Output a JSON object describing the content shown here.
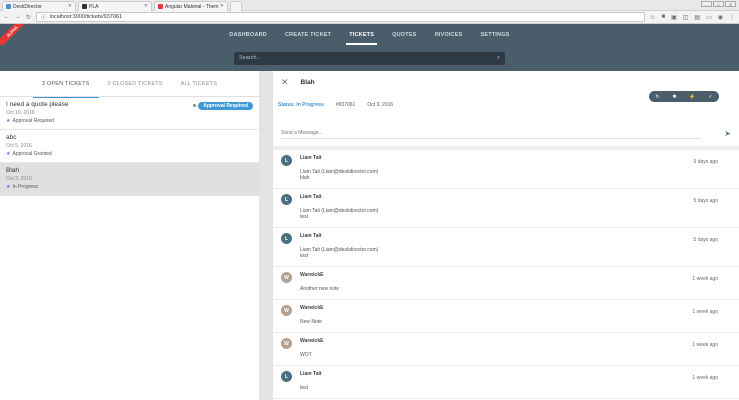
{
  "browser": {
    "tabs": [
      {
        "title": "DeskDirector",
        "fav": "#4a90d9"
      },
      {
        "title": "PLA",
        "fav": "#333333"
      },
      {
        "title": "Angular Material - Them",
        "fav": "#e53935"
      }
    ],
    "url": "localhost:3000/tickets/937061"
  },
  "badge": "ALPHA",
  "nav": {
    "items": [
      "DASHBOARD",
      "CREATE TICKET",
      "TICKETS",
      "QUOTES",
      "INVOICES",
      "SETTINGS"
    ],
    "active": 2
  },
  "search": {
    "placeholder": "Search..."
  },
  "list_tabs": [
    "3 OPEN TICKETS",
    "2 CLOSED TICKETS",
    "ALL TICKETS"
  ],
  "tickets": [
    {
      "title": "I need a quote please",
      "date": "Oct 10, 2016",
      "status": "Approval Required",
      "badge": "Approval Required"
    },
    {
      "title": "abc",
      "date": "Oct 5, 2016",
      "status": "Approval Granted"
    },
    {
      "title": "Blah",
      "date": "Oct 3, 2016",
      "status": "In Progress"
    }
  ],
  "detail": {
    "title": "Blah",
    "status": "Status: In Progress",
    "ticket_no": "#937061",
    "date": "Oct 3, 2016",
    "message_placeholder": "Send a Message..."
  },
  "feed": [
    {
      "initial": "L",
      "name": "Liam Tait",
      "time": "5 days ago",
      "line1": "Liam Tait (Liam@deskdirector.com)",
      "line2": "blah"
    },
    {
      "initial": "L",
      "name": "Liam Tait",
      "time": "5 days ago",
      "line1": "Liam Tait (Liam@deskdirector.com)",
      "line2": "test"
    },
    {
      "initial": "L",
      "name": "Liam Tait",
      "time": "5 days ago",
      "line1": "Liam Tait (Liam@deskdirector.com)",
      "line2": "test"
    },
    {
      "initial": "W",
      "name": "WarwickE",
      "time": "1 week ago",
      "body": "Another new note"
    },
    {
      "initial": "W",
      "name": "WarwickE",
      "time": "1 week ago",
      "body": "New Note"
    },
    {
      "initial": "W",
      "name": "WarwickE",
      "time": "1 week ago",
      "body": "WOT"
    },
    {
      "initial": "L",
      "name": "Liam Tait",
      "time": "1 week ago",
      "body": "test"
    }
  ]
}
